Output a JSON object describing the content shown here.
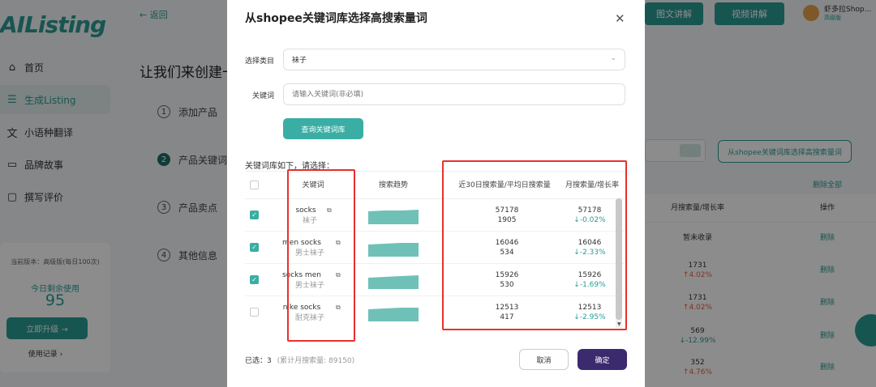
{
  "app": {
    "brand": "AIListing"
  },
  "sidebar": {
    "items": [
      {
        "icon": "home-icon",
        "glyph": "⌂",
        "label": "首页"
      },
      {
        "icon": "list-icon",
        "glyph": "☰",
        "label": "生成Listing"
      },
      {
        "icon": "translate-icon",
        "glyph": "文",
        "label": "小语种翻译"
      },
      {
        "icon": "book-icon",
        "glyph": "▭",
        "label": "品牌故事"
      },
      {
        "icon": "comment-icon",
        "glyph": "▢",
        "label": "撰写评价"
      }
    ],
    "plan": {
      "version": "当前版本：高级版(每日100次)",
      "remaining_label": "今日剩余使用",
      "remaining": "95",
      "upgrade": "立即升级 →",
      "history": "使用记录 ›"
    }
  },
  "page": {
    "back": "← 返回",
    "heading": "让我们来创建一",
    "steps": [
      {
        "num": "1",
        "label": "添加产品"
      },
      {
        "num": "2",
        "label": "产品关键词"
      },
      {
        "num": "3",
        "label": "产品卖点"
      },
      {
        "num": "4",
        "label": "其他信息"
      }
    ]
  },
  "topbar": {
    "tutorial_text": "图文讲解",
    "tutorial_video": "视频讲解",
    "user": "虾多拉Shop...",
    "user_badge": "高级版"
  },
  "bg_panel": {
    "select_button": "从shopee关键词库选择高搜索量词",
    "delete_all": "删除全部",
    "col_volume": "月搜索量/增长率",
    "col_action": "操作",
    "rows": [
      {
        "vol": "暂未收录",
        "rate": "",
        "dir": "none",
        "action": "删除"
      },
      {
        "vol": "1731",
        "rate": "↑4.02%",
        "dir": "up",
        "action": "删除"
      },
      {
        "vol": "1731",
        "rate": "↑4.02%",
        "dir": "up",
        "action": "删除"
      },
      {
        "vol": "569",
        "rate": "↓-12.99%",
        "dir": "down",
        "action": "删除"
      },
      {
        "vol": "352",
        "rate": "↑4.76%",
        "dir": "up",
        "action": "删除"
      }
    ]
  },
  "modal": {
    "title": "从shopee关键词库选择高搜索量词",
    "category_label": "选择类目",
    "category_value": "袜子",
    "keyword_label": "关键词",
    "keyword_placeholder": "请输入关键词(非必填)",
    "query_button": "查询关键词库",
    "list_caption": "关键词库如下，请选择：",
    "headers": {
      "keyword": "关键词",
      "trend": "搜索趋势",
      "volume30": "近30日搜索量/平均日搜索量",
      "monthly": "月搜索量/增长率"
    },
    "rows": [
      {
        "checked": true,
        "keyword": "socks",
        "translation": "袜子",
        "vol30": "57178",
        "daily": "1905",
        "monthly": "57178",
        "rate": "↓-0.02%"
      },
      {
        "checked": true,
        "keyword": "men socks",
        "translation": "男士袜子",
        "vol30": "16046",
        "daily": "534",
        "monthly": "16046",
        "rate": "↓-2.33%"
      },
      {
        "checked": true,
        "keyword": "socks men",
        "translation": "男士袜子",
        "vol30": "15926",
        "daily": "530",
        "monthly": "15926",
        "rate": "↓-1.69%"
      },
      {
        "checked": false,
        "keyword": "nike socks",
        "translation": "耐克袜子",
        "vol30": "12513",
        "daily": "417",
        "monthly": "12513",
        "rate": "↓-2.95%"
      }
    ],
    "selected_label": "已选：3",
    "selected_total": "(累计月搜索量: 89150)",
    "cancel": "取消",
    "confirm": "确定"
  },
  "colors": {
    "accent": "#3aaea4",
    "primary_dark": "#3c2a6e",
    "highlight": "#e8312c",
    "down": "#2a9c94",
    "up": "#e8613a"
  }
}
